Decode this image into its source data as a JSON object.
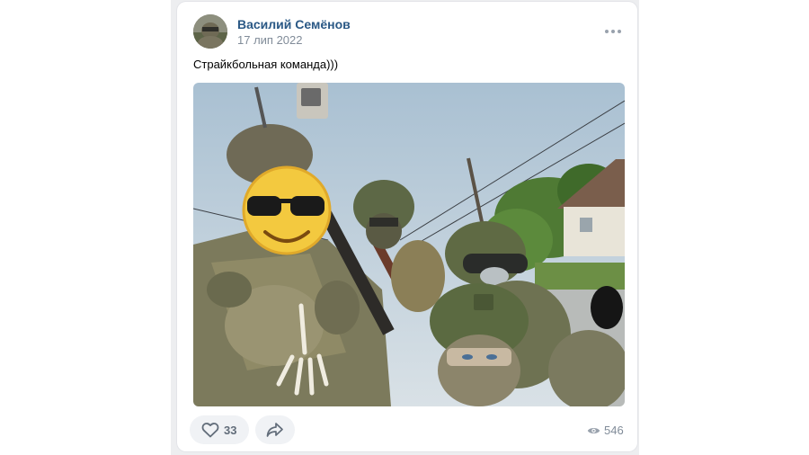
{
  "post": {
    "author_name": "Василий Семёнов",
    "date": "17 лип 2022",
    "text": "Страйкбольная команда)))",
    "likes": "33",
    "views": "546"
  },
  "icons": {
    "more": "more-horizontal-icon",
    "like": "heart-icon",
    "share": "share-arrow-icon",
    "views": "eye-icon",
    "sticker": "sunglasses-emoji-icon"
  },
  "colors": {
    "author_link": "#2a5885",
    "secondary_text": "#818c99",
    "button_bg": "#f0f2f5",
    "page_bg": "#edeef0"
  }
}
